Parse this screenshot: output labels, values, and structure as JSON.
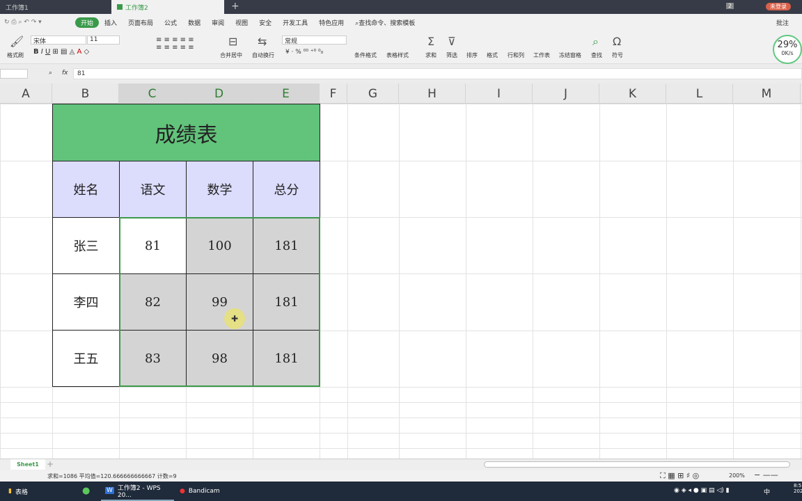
{
  "tabs": [
    {
      "label": "工作簿1"
    },
    {
      "label": "工作簿2"
    }
  ],
  "login_button": "未登录",
  "window_badge": "2",
  "menu": [
    "开始",
    "插入",
    "页面布局",
    "公式",
    "数据",
    "审阅",
    "视图",
    "安全",
    "开发工具",
    "特色应用"
  ],
  "search_command": "查找命令、搜索模板",
  "comment": "批注",
  "toolbar": {
    "format_painter": "格式刷",
    "font": "宋体",
    "font_size": "11",
    "merge": "合并居中",
    "wrap": "自动换行",
    "number_format": "常规",
    "cond_format": "条件格式",
    "table_style": "表格样式",
    "sum": "求和",
    "filter": "筛选",
    "sort": "排序",
    "format": "格式",
    "rowcol": "行和列",
    "sheet": "工作表",
    "freeze": "冻结窗格",
    "find": "查找",
    "symbol": "符号"
  },
  "speed": {
    "percent": "29%",
    "rate": "0K/s"
  },
  "formula": {
    "fx": "fx",
    "value": "81"
  },
  "columns": [
    "A",
    "B",
    "C",
    "D",
    "E",
    "F",
    "G",
    "H",
    "I",
    "J",
    "K",
    "L",
    "M"
  ],
  "table": {
    "title": "成绩表",
    "headers": [
      "姓名",
      "语文",
      "数学",
      "总分"
    ],
    "rows": [
      [
        "张三",
        "81",
        "100",
        "181"
      ],
      [
        "李四",
        "82",
        "99",
        "181"
      ],
      [
        "王五",
        "83",
        "98",
        "181"
      ]
    ]
  },
  "colors": {
    "title_bg": "#62c37b",
    "header_bg": "#dcdcfc",
    "selection": "#d4d4d4",
    "accent": "#3a9a4a"
  },
  "sheet_tab": "Sheet1",
  "status": "求和=1086  平均值=120.666666666667  计数=9",
  "zoom": "200%",
  "taskbar": {
    "folder": "表格",
    "wps": "工作簿2 - WPS 20...",
    "bandicam": "Bandicam",
    "ime": "中",
    "time": "8:5",
    "date": "202"
  }
}
